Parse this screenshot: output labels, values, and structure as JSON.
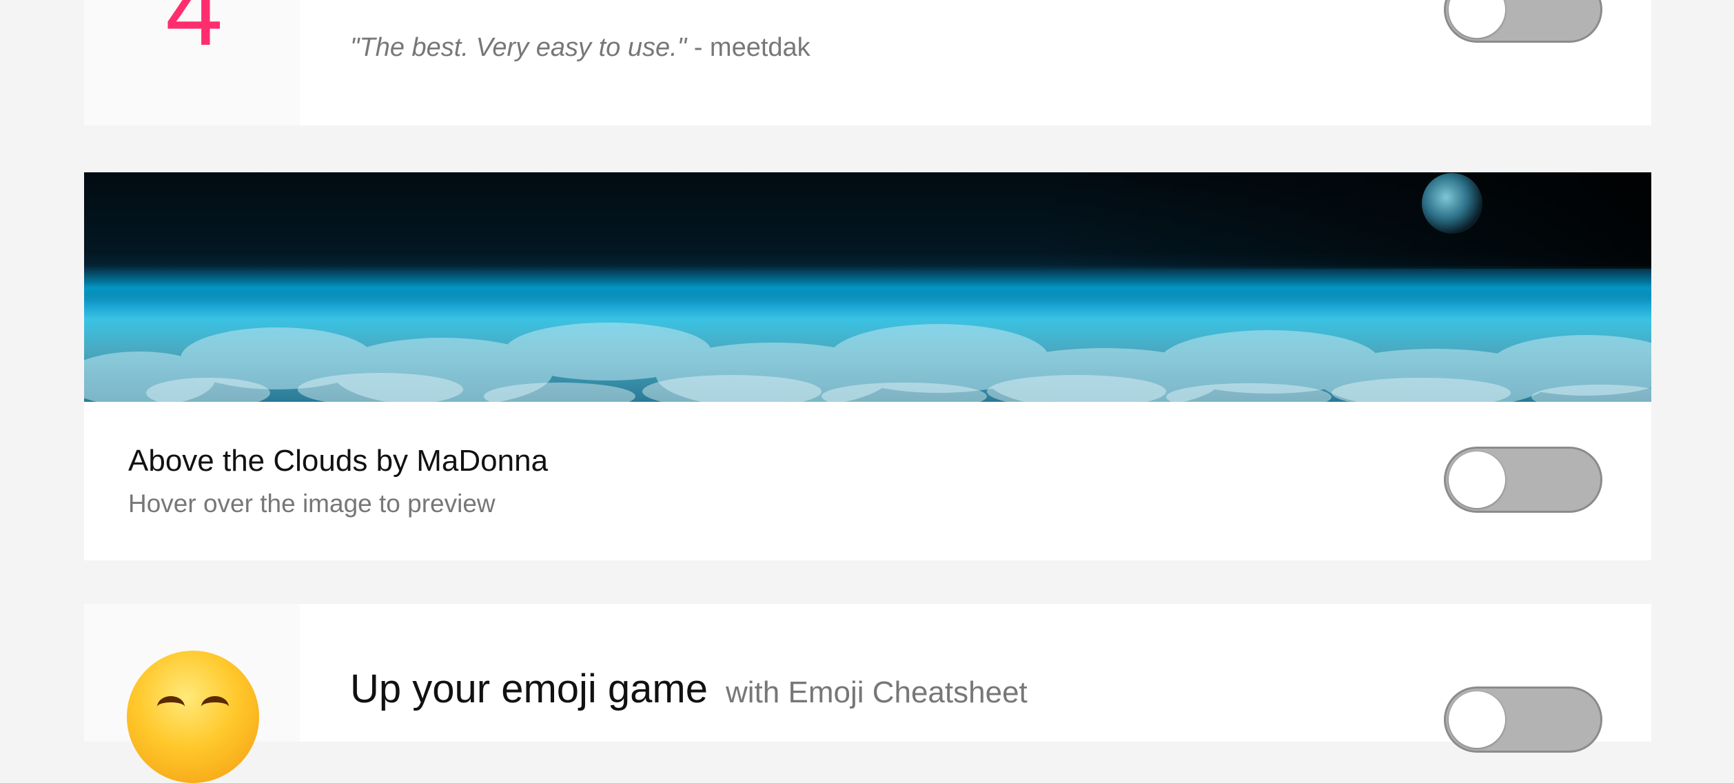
{
  "top_card": {
    "feature_number": "4",
    "quote": "\"The best. Very easy to use.\"",
    "quote_author": " - meetdak",
    "toggle_on": false
  },
  "theme_card": {
    "title": "Above the Clouds by MaDonna",
    "subtitle": "Hover over the image to preview",
    "toggle_on": false,
    "colors": {
      "sky": "#031722",
      "horizon": "#1aa3d3",
      "clouds": "#4aa9c0"
    }
  },
  "emoji_card": {
    "heading": "Up your emoji game",
    "subheading": "with Emoji Cheatsheet",
    "icon": "smiling-emoji-icon",
    "toggle_on": false
  },
  "colors": {
    "accent_pink": "#ff2d6e",
    "toggle_off": "#b3b3b3",
    "page_bg": "#f4f4f4"
  }
}
